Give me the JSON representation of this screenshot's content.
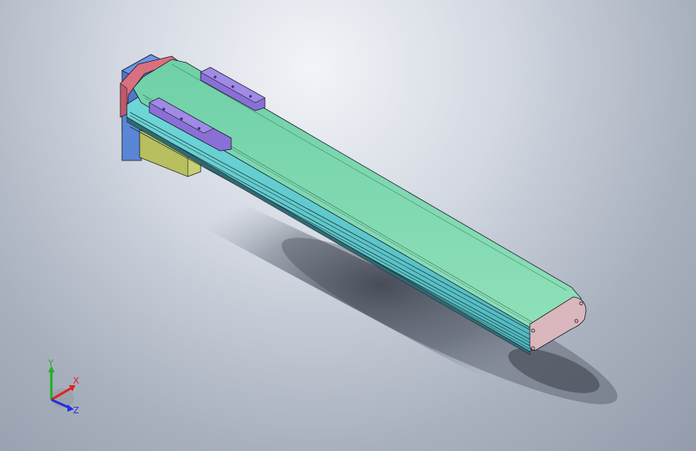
{
  "viewport": {
    "background_top": "#eef1f6",
    "background_bottom": "#939cab"
  },
  "model": {
    "parts": [
      {
        "name": "rail-top-cover",
        "color": "#7fd8a8"
      },
      {
        "name": "rail-side-profile",
        "color": "#5fc8c8"
      },
      {
        "name": "end-cap",
        "color": "#d9b7bd"
      },
      {
        "name": "motor-flange",
        "color": "#d9707f"
      },
      {
        "name": "motor-housing",
        "color": "#5a86d6"
      },
      {
        "name": "motor-adapter",
        "color": "#c9d070"
      },
      {
        "name": "slider-block",
        "color": "#8a70d6"
      }
    ]
  },
  "triad": {
    "x_label": "X",
    "y_label": "Y",
    "z_label": "Z",
    "x_color": "#e02020",
    "y_color": "#20b020",
    "z_color": "#2030e0"
  }
}
